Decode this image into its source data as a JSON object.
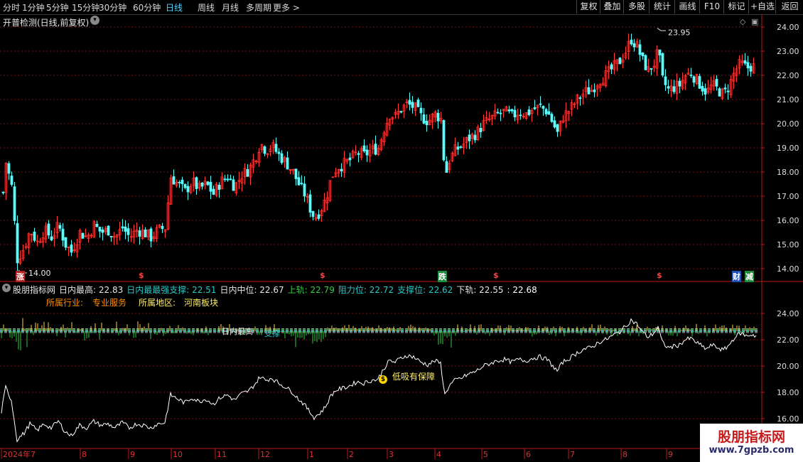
{
  "toolbar": {
    "periods": [
      "分时",
      "1分钟",
      "5分钟",
      "15分钟",
      "30分钟",
      "60分钟",
      "日线",
      "周线",
      "月线",
      "多周期",
      "更多 >"
    ],
    "active_period": "日线",
    "right_buttons": [
      "复权",
      "叠加",
      "多股",
      "统计",
      "画线",
      "F10",
      "标记",
      "+自选",
      "返回"
    ]
  },
  "main_chart": {
    "title": "开普检测(日线,前复权)",
    "y_ticks": [
      "24.00",
      "23.00",
      "22.00",
      "21.00",
      "20.00",
      "19.00",
      "18.00",
      "17.00",
      "16.00",
      "15.00",
      "14.00"
    ],
    "high_label": "23.95",
    "low_label": "14.00",
    "signals": {
      "zhang": "涨",
      "dollar": "$",
      "die": "跌",
      "cai": "财",
      "jian": "减"
    }
  },
  "indicator": {
    "name": "股朋指标网",
    "values": [
      {
        "label": "日内最高: 22.83",
        "color": "#e6e6e6"
      },
      {
        "label": "日内最最强支撑: 22.51",
        "color": "#28c9c9"
      },
      {
        "label": "日内中位: 22.67",
        "color": "#e6e6e6"
      },
      {
        "label": "上轨: 22.79",
        "color": "#2ecc40"
      },
      {
        "label": "阻力位: 22.72",
        "color": "#28c9c9"
      },
      {
        "label": "支撑位: 22.62",
        "color": "#28c9c9"
      },
      {
        "label": "下轨: 22.55",
        "color": "#e6e6e6"
      },
      {
        "label": ": 22.68",
        "color": "#ffffff"
      }
    ],
    "industry_label": "所属行业:",
    "industry_value": "专业服务",
    "region_label": "所属地区:",
    "region_value": "河南板块",
    "y_ticks": [
      "24.00",
      "22.00",
      "20.00",
      "18.00",
      "16.00"
    ],
    "overlap_text": "日内最高",
    "support_text": "支撑",
    "buy_label": "低吸有保障",
    "buy_icon": "$"
  },
  "x_axis": {
    "labels": [
      "2024年7",
      "8",
      "9",
      "10",
      "11",
      "12",
      "1",
      "2",
      "3",
      "4",
      "5",
      "6",
      "7",
      "8",
      "9"
    ]
  },
  "watermark": {
    "title": "股朋指标网",
    "url": "www.7gpzb.com"
  },
  "colors": {
    "up": "#ff3b3b",
    "down": "#54ffff",
    "grid": "#7a1010",
    "axis": "#c01818",
    "bg": "#000000"
  }
}
